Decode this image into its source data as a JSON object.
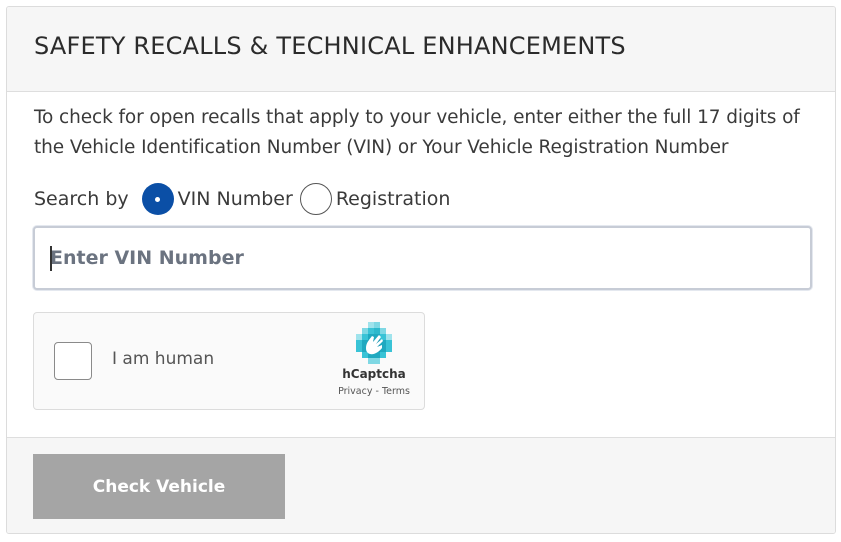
{
  "header": {
    "title": "SAFETY RECALLS & TECHNICAL ENHANCEMENTS"
  },
  "intro": {
    "text": "To check for open recalls that apply to your vehicle, enter either the full 17 digits of the Vehicle Identification Number (VIN) or Your Vehicle Registration Number"
  },
  "search": {
    "label": "Search by",
    "options": [
      {
        "label": "VIN Number",
        "selected": true
      },
      {
        "label": "Registration",
        "selected": false
      }
    ],
    "input_placeholder": "Enter VIN Number",
    "input_value": ""
  },
  "captcha": {
    "label": "I am human",
    "brand": "hCaptcha",
    "links": "Privacy - Terms",
    "checked": false
  },
  "footer": {
    "submit_label": "Check Vehicle"
  },
  "colors": {
    "accent": "#0b4fa6",
    "button_disabled": "#a5a5a5",
    "header_bg": "#f6f6f6",
    "hcaptcha_teal": "#1fb5c8"
  }
}
